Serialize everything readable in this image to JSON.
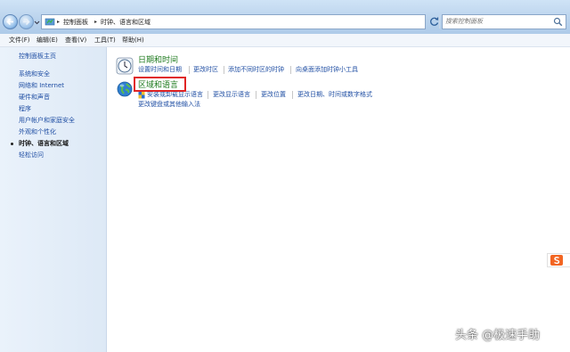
{
  "address_bar": {
    "crumbs": [
      "控制面板",
      "时钟、语言和区域"
    ]
  },
  "search": {
    "placeholder": "搜索控制面板"
  },
  "menu": {
    "items": [
      "文件(F)",
      "编辑(E)",
      "查看(V)",
      "工具(T)",
      "帮助(H)"
    ]
  },
  "sidebar": {
    "home": "控制面板主页",
    "items": [
      "系统和安全",
      "网络和 Internet",
      "硬件和声音",
      "程序",
      "用户帐户和家庭安全",
      "外观和个性化",
      "时钟、语言和区域",
      "轻松访问"
    ],
    "current_index": 6
  },
  "categories": [
    {
      "title": "日期和时间",
      "links": [
        "设置时间和日期",
        "更改时区",
        "添加不同时区的时钟",
        "向桌面添加时钟小工具"
      ]
    },
    {
      "title": "区域和语言",
      "links": [
        "安装或卸载显示语言",
        "更改显示语言",
        "更改位置",
        "更改日期、时间或数字格式",
        "更改键盘或其他输入法"
      ]
    }
  ],
  "watermark": "头条 @极速手助",
  "colors": {
    "link": "#1f4ea3",
    "category_title": "#1e7a1e",
    "highlight": "#e02424"
  }
}
